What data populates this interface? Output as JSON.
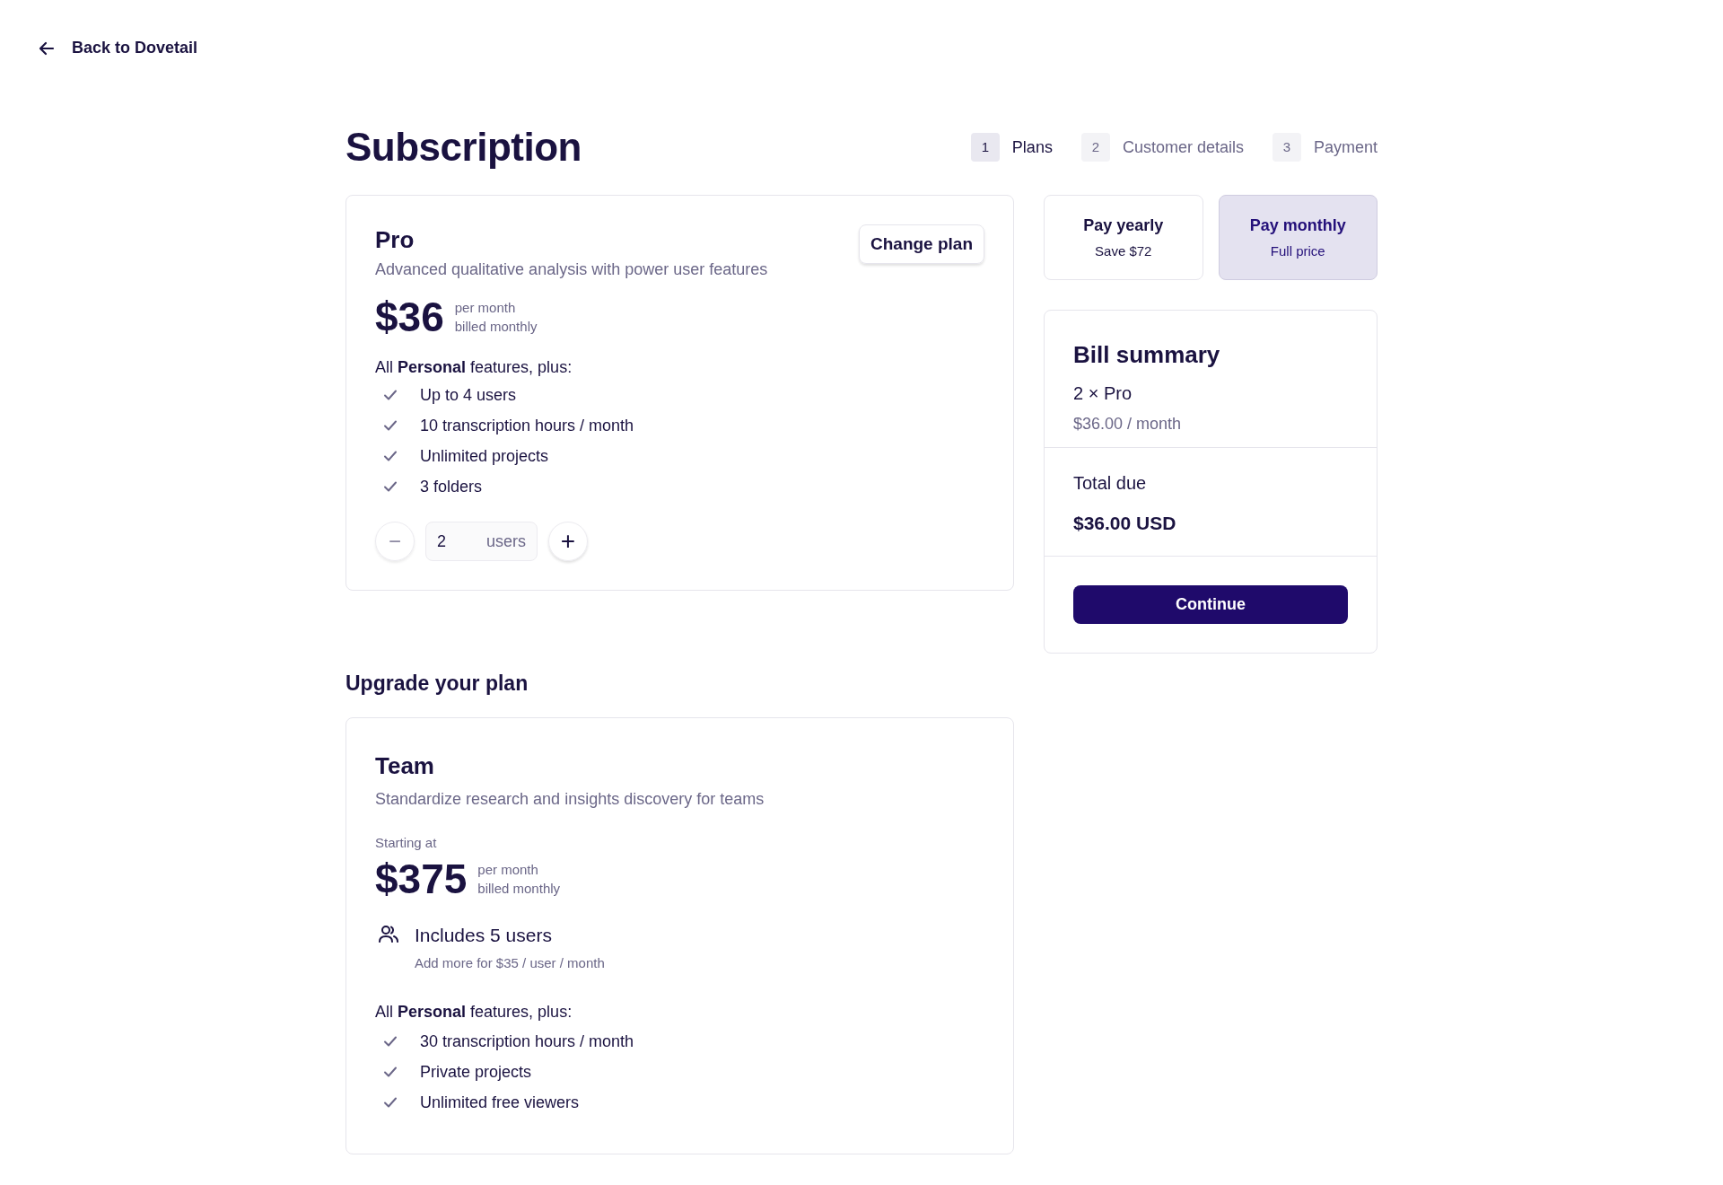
{
  "back_link": "Back to Dovetail",
  "title": "Subscription",
  "steps": [
    {
      "number": "1",
      "label": "Plans",
      "selected": true
    },
    {
      "number": "2",
      "label": "Customer details",
      "selected": false
    },
    {
      "number": "3",
      "label": "Payment",
      "selected": false
    }
  ],
  "current_plan": {
    "name": "Pro",
    "description": "Advanced qualitative analysis with power user features",
    "change_button": "Change plan",
    "price": "$36",
    "period": "per month",
    "billing": "billed monthly",
    "features_intro": "All **Personal** features, plus:",
    "features": [
      "Up to 4 users",
      "10 transcription hours / month",
      "Unlimited projects",
      "3 folders"
    ],
    "seats": {
      "decrement": "−",
      "value": "2",
      "unit": "users",
      "increment": "+"
    }
  },
  "billing_options": [
    {
      "label": "Pay yearly",
      "note": "Save $72",
      "selected": false
    },
    {
      "label": "Pay monthly",
      "note": "Full price",
      "selected": true
    }
  ],
  "bill_summary": {
    "title": "Bill summary",
    "item": "2 × Pro",
    "item_price": "$36.00 / month",
    "total_label": "Total due",
    "total": "$36.00 USD",
    "button": "Continue"
  },
  "upgrade": {
    "heading": "Upgrade your plan",
    "name": "Team",
    "description": "Standardize research and insights discovery for teams",
    "starting": "Starting at",
    "price": "$375",
    "period": "per month",
    "billing": "billed monthly",
    "includes": "Includes 5 users",
    "includes_note": "Add more for $35 / user / month",
    "features_intro": "All **Personal** features, plus:",
    "features": [
      "30 transcription hours / month",
      "Private projects",
      "Unlimited free viewers"
    ]
  }
}
